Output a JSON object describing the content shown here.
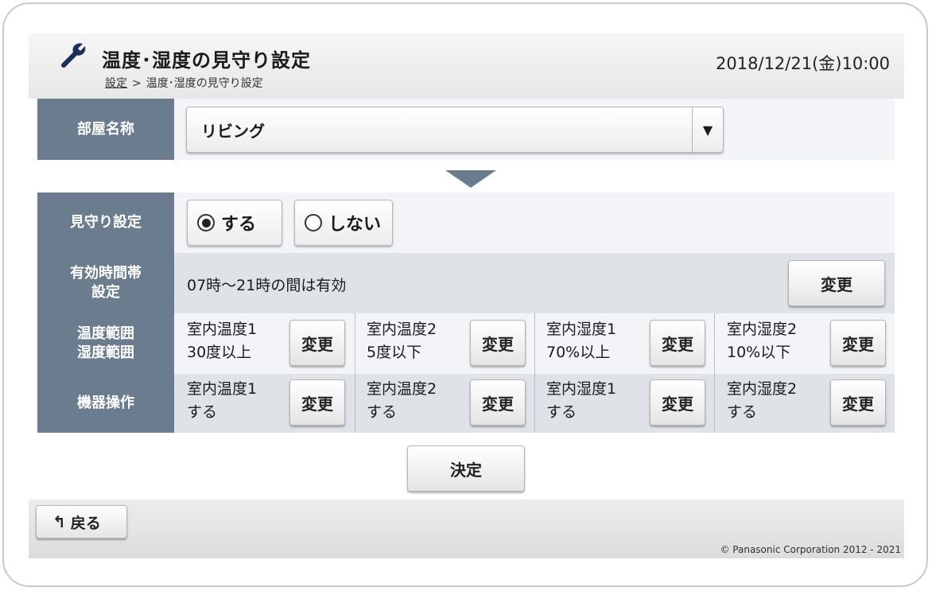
{
  "header": {
    "title": "温度･湿度の見守り設定",
    "breadcrumb_link": "設定",
    "breadcrumb_sep": ">",
    "breadcrumb_current": "温度･湿度の見守り設定",
    "datetime": "2018/12/21(金)10:00",
    "icon": "wrench-icon"
  },
  "room": {
    "label": "部屋名称",
    "value": "リビング",
    "arrow": "▼"
  },
  "watch": {
    "label": "見守り設定",
    "options": [
      {
        "label": "する",
        "selected": true
      },
      {
        "label": "しない",
        "selected": false
      }
    ]
  },
  "hours": {
    "label_line1": "有効時間帯",
    "label_line2": "設定",
    "text": "07時〜21時の間は有効",
    "change_label": "変更"
  },
  "range": {
    "label_line1": "温度範囲",
    "label_line2": "湿度範囲",
    "cells": [
      {
        "line1": "室内温度1",
        "line2": "30度以上",
        "button": "変更"
      },
      {
        "line1": "室内温度2",
        "line2": "5度以下",
        "button": "変更"
      },
      {
        "line1": "室内湿度1",
        "line2": "70%以上",
        "button": "変更"
      },
      {
        "line1": "室内湿度2",
        "line2": "10%以下",
        "button": "変更"
      }
    ]
  },
  "device": {
    "label": "機器操作",
    "cells": [
      {
        "line1": "室内温度1",
        "line2": "する",
        "button": "変更"
      },
      {
        "line1": "室内温度2",
        "line2": "する",
        "button": "変更"
      },
      {
        "line1": "室内湿度1",
        "line2": "する",
        "button": "変更"
      },
      {
        "line1": "室内湿度2",
        "line2": "する",
        "button": "変更"
      }
    ]
  },
  "actions": {
    "confirm_label": "決定",
    "back_label": "戻る",
    "back_icon": "↰"
  },
  "footer": {
    "copyright": "© Panasonic Corporation 2012 - 2021"
  },
  "colors": {
    "label_bg": "#6a7c8d",
    "row_light": "#f3f4f7",
    "row_alt": "#dfe3e8"
  }
}
